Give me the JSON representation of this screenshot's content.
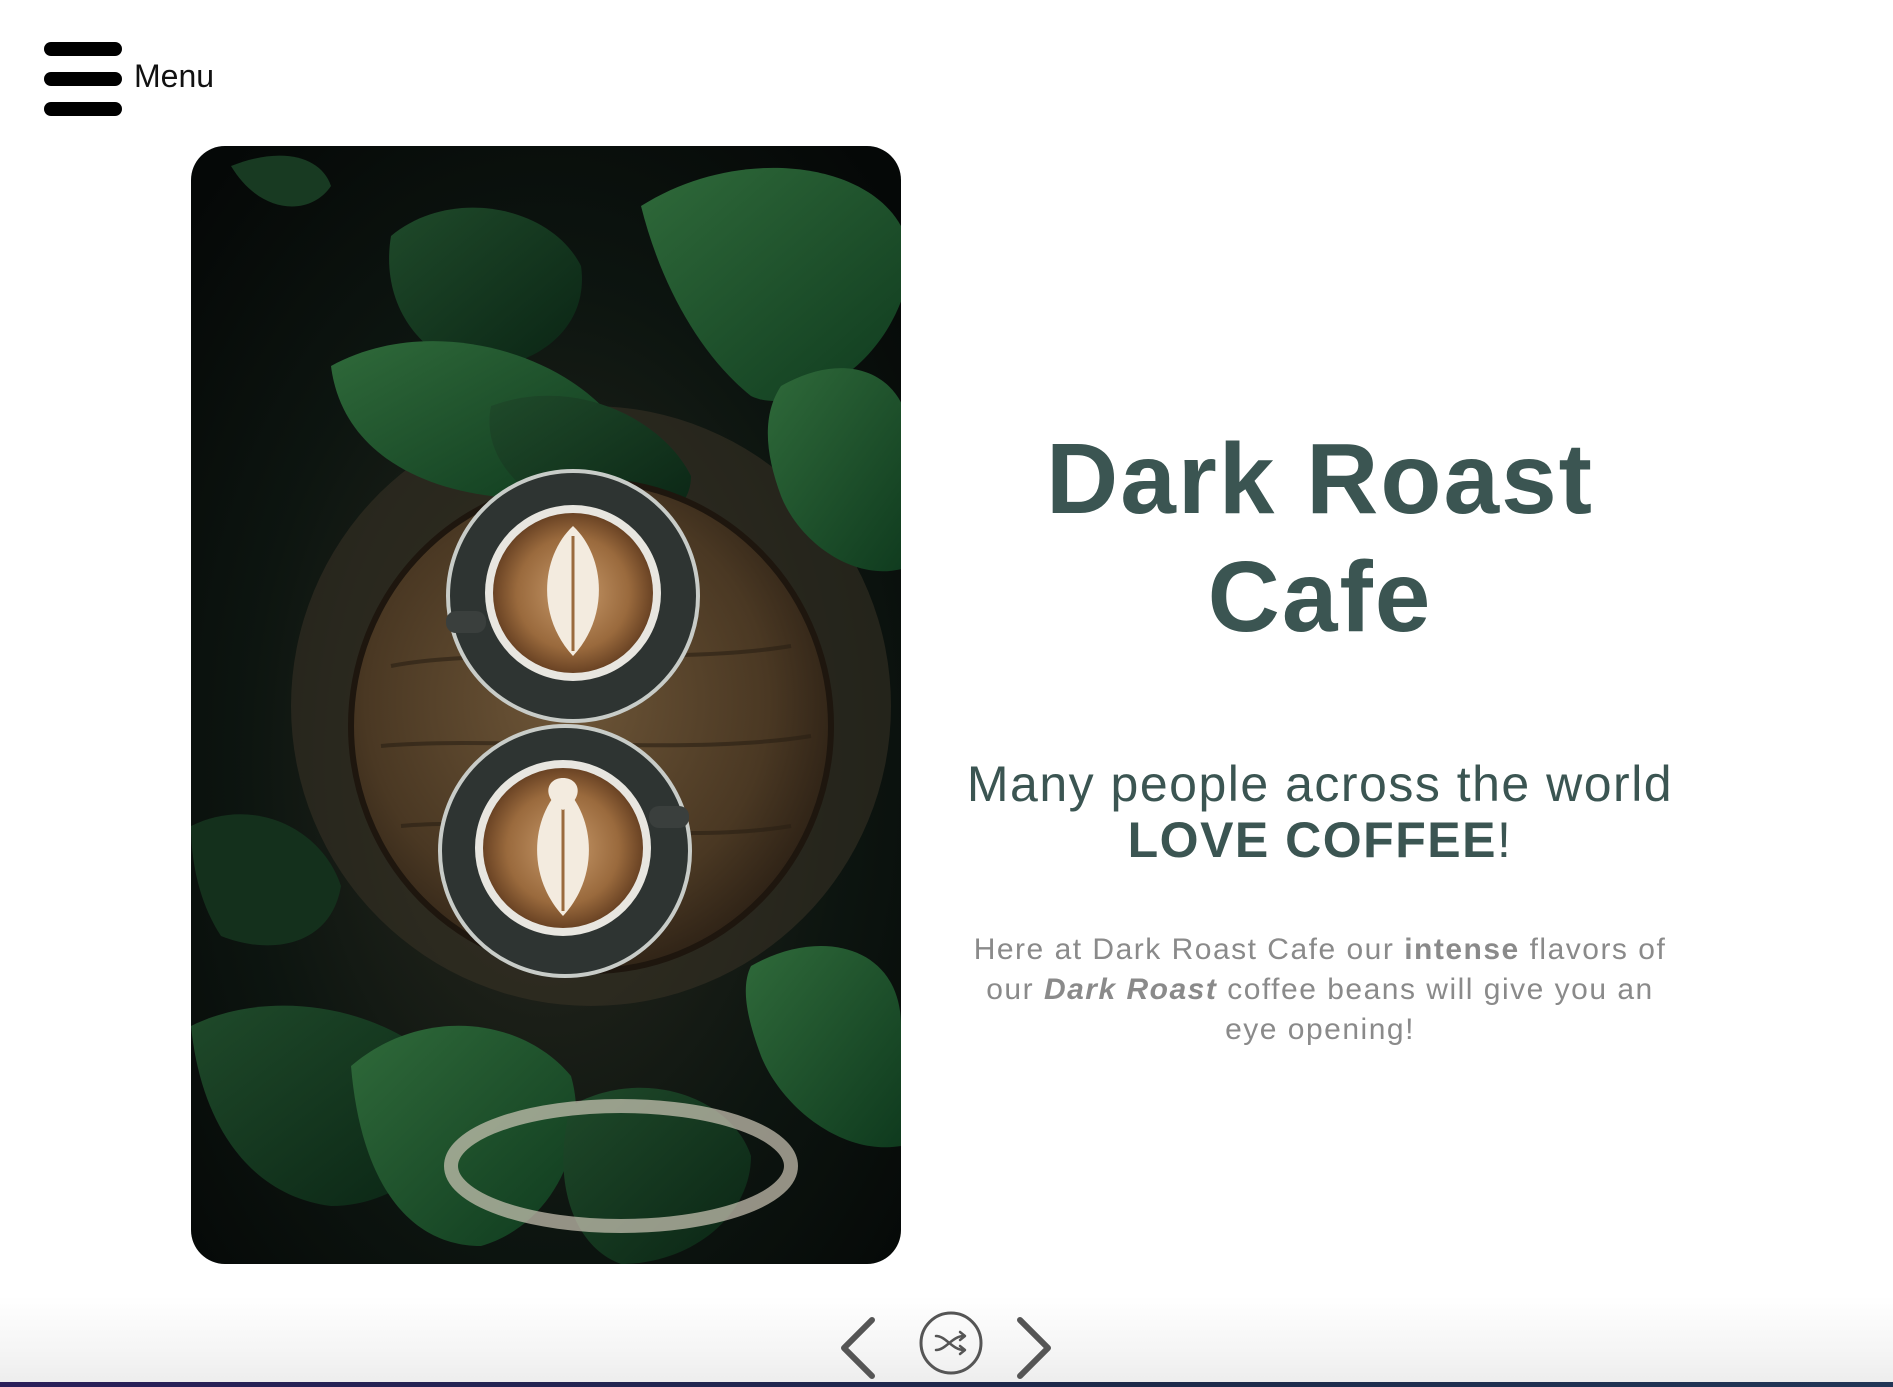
{
  "menu": {
    "label": "Menu",
    "icon": "hamburger-icon"
  },
  "hero": {
    "title_line1": "Dark Roast",
    "title_line2": "Cafe",
    "tagline_prefix": "Many people across the world",
    "tagline_emphasis": "LOVE COFFEE",
    "tagline_suffix": "!",
    "description_part1": "Here at Dark Roast Cafe our ",
    "description_bold": "intense",
    "description_part2": " flavors of our ",
    "description_italic": "Dark Roast",
    "description_part3": " coffee beans will give you an eye opening!"
  },
  "controls": {
    "prev_icon": "chevron-left-icon",
    "shuffle_icon": "shuffle-icon",
    "next_icon": "chevron-right-icon"
  },
  "colors": {
    "title": "#3b5552",
    "description": "#8a8a8a",
    "background": "#ffffff"
  }
}
